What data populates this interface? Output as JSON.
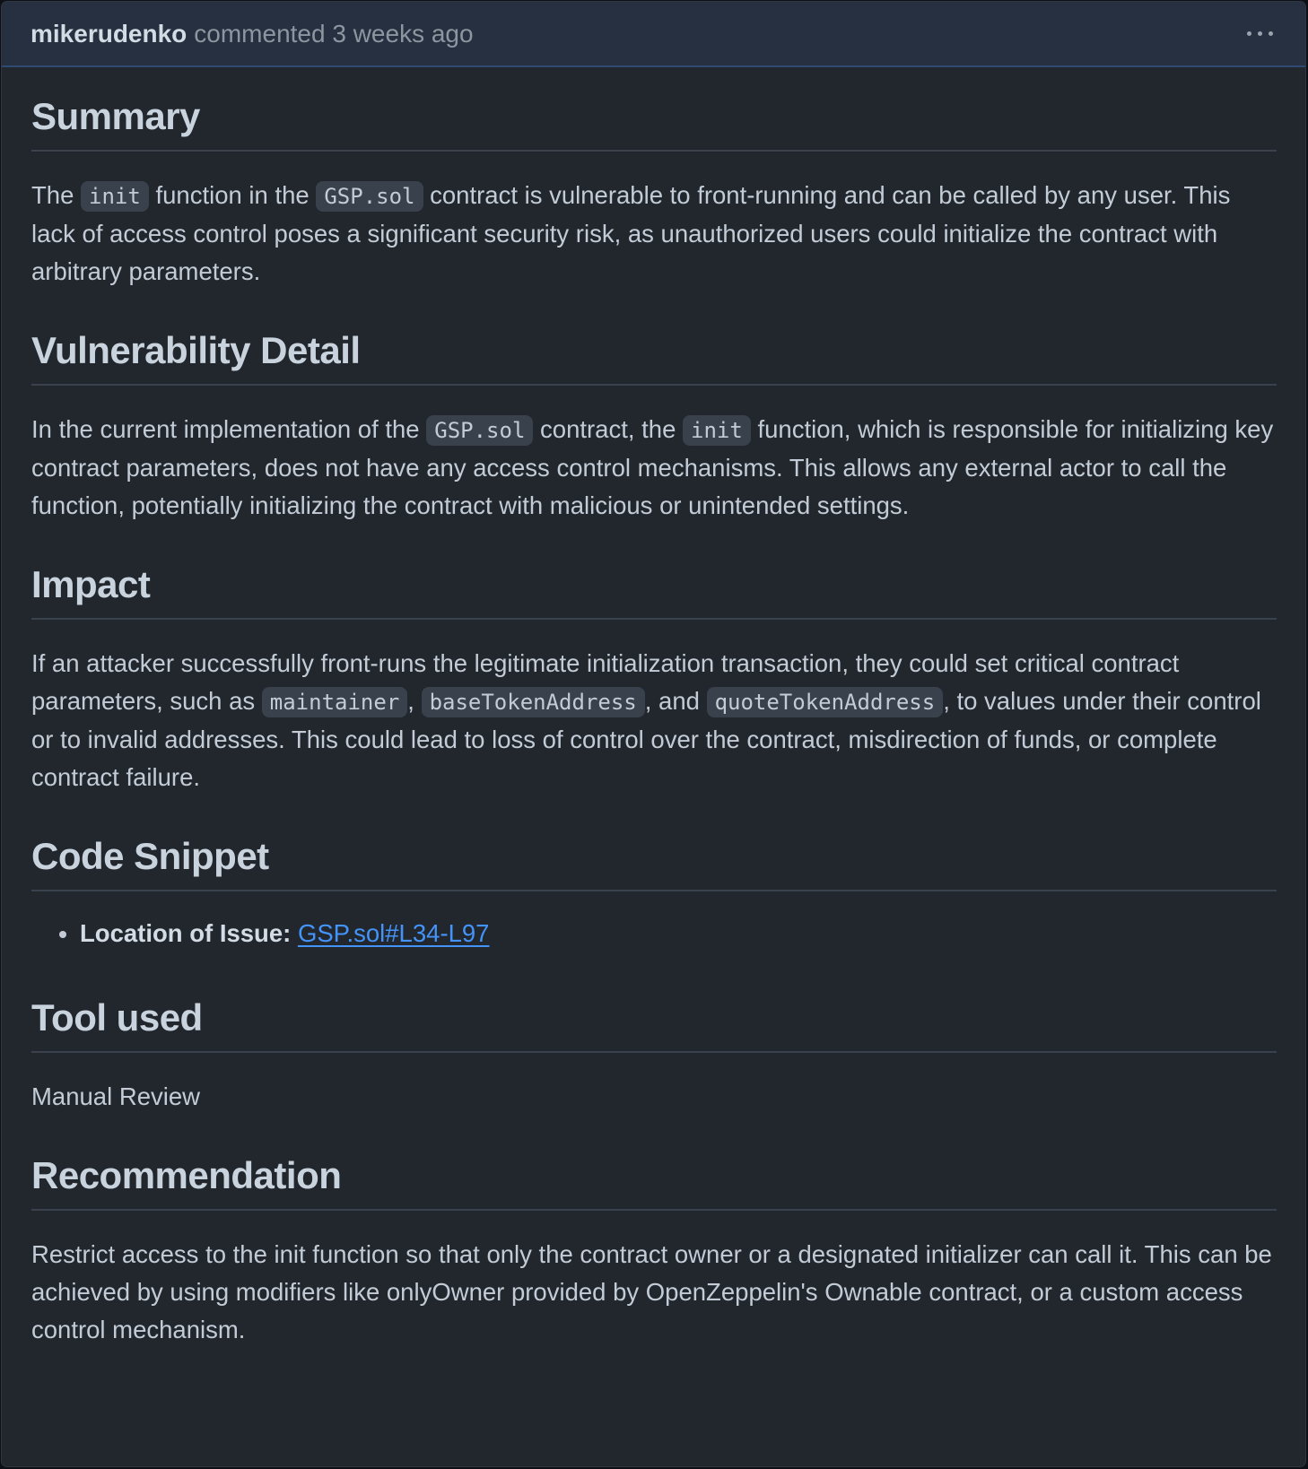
{
  "header": {
    "author": "mikerudenko",
    "meta": "commented 3 weeks ago",
    "menu_icon": "kebab-horizontal-icon"
  },
  "summary": {
    "heading": "Summary",
    "p_text1": "The",
    "code1": "init",
    "p_text2": "function in the",
    "code2": "GSP.sol",
    "p_text3": "contract is vulnerable to front-running and can be called by any user. This lack of access control poses a significant security risk, as unauthorized users could initialize the contract with arbitrary parameters."
  },
  "vulnerability": {
    "heading": "Vulnerability Detail",
    "p_text1": "In the current implementation of the",
    "code1": "GSP.sol",
    "p_text2": "contract, the",
    "code2": "init",
    "p_text3": "function, which is responsible for initializing key contract parameters, does not have any access control mechanisms. This allows any external actor to call the function, potentially initializing the contract with malicious or unintended settings."
  },
  "impact": {
    "heading": "Impact",
    "p_text1": "If an attacker successfully front-runs the legitimate initialization transaction, they could set critical contract parameters, such as",
    "code1": "maintainer",
    "sep1": ",",
    "code2": "baseTokenAddress",
    "p_text2": ", and",
    "code3": "quoteTokenAddress",
    "p_text3": ", to values under their control or to invalid addresses. This could lead to loss of control over the contract, misdirection of funds, or complete contract failure."
  },
  "code_snippet": {
    "heading": "Code Snippet",
    "item_label": "Location of Issue:",
    "item_link": "GSP.sol#L34-L97"
  },
  "tool": {
    "heading": "Tool used",
    "text": "Manual Review"
  },
  "recommendation": {
    "heading": "Recommendation",
    "text": "Restrict access to the init function so that only the contract owner or a designated initializer can call it. This can be achieved by using modifiers like onlyOwner provided by OpenZeppelin's Ownable contract, or a custom access control mechanism."
  }
}
